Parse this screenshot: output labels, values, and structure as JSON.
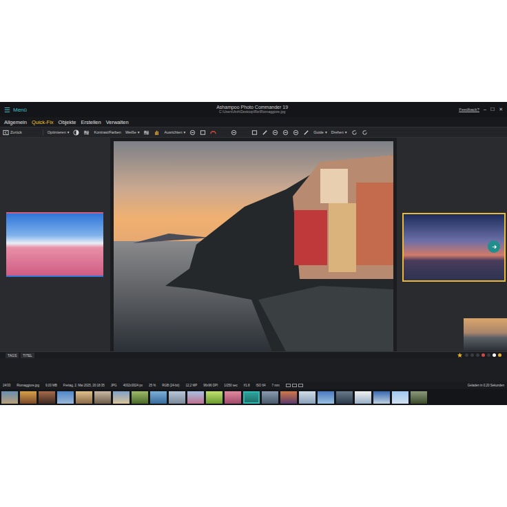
{
  "window": {
    "menu_icon": "☰",
    "menu_label": "Menü",
    "title": "Ashampoo Photo Commander 19",
    "path": "C:\\Users\\Anh\\Desktop\\Rio\\Riomaggiore.jpg",
    "feedback": "Feedback?",
    "controls": [
      "–",
      "☐",
      "✕"
    ]
  },
  "tabs": [
    {
      "label": "Allgemein",
      "selected": false
    },
    {
      "label": "Quick-Fix",
      "selected": true
    },
    {
      "label": "Objekte",
      "selected": false
    },
    {
      "label": "Erstellen",
      "selected": false
    },
    {
      "label": "Verwalten",
      "selected": false
    }
  ],
  "toolbar": {
    "back": "Zurück",
    "items": [
      {
        "label": "Optimieren",
        "arrow": "▾"
      },
      {
        "label": "Kontrast/Farben",
        "arrow": ""
      },
      {
        "label": "Weiße",
        "arrow": "▾"
      },
      {
        "label": "Ausrichten",
        "arrow": "▾"
      },
      {
        "label": "Guide",
        "arrow": "▾"
      },
      {
        "label": "Drehen",
        "arrow": "▾"
      }
    ]
  },
  "neighbors": {
    "previous": {
      "selected": false
    },
    "next": {
      "selected": true
    }
  },
  "info_tabs": [
    "TAGS",
    "TITEL"
  ],
  "status_bar": {
    "fields": [
      "24/33",
      "Riomaggiore.jpg",
      "9,03 MB",
      "Freitag, 2. Mai 2025, 20:18:35",
      "JPG",
      "4032x3024 px",
      "25 %",
      "RGB (24-bit)",
      "12,2 MP",
      "96x96 DPI",
      "1/250 sec",
      "f/1.8",
      "ISO 64",
      "7 mm"
    ],
    "load_time": "Geladen in 0,20 Sekunden"
  },
  "filmstrip": {
    "items": [
      {
        "selected": false
      },
      {
        "selected": false
      },
      {
        "selected": false
      },
      {
        "selected": false
      },
      {
        "selected": false
      },
      {
        "selected": false
      },
      {
        "selected": false
      },
      {
        "selected": false
      },
      {
        "selected": false
      },
      {
        "selected": false
      },
      {
        "selected": false
      },
      {
        "selected": false
      },
      {
        "selected": false
      },
      {
        "selected": true
      },
      {
        "selected": false
      },
      {
        "selected": false
      },
      {
        "selected": false
      },
      {
        "selected": false
      },
      {
        "selected": false
      },
      {
        "selected": false
      },
      {
        "selected": false
      },
      {
        "selected": false
      },
      {
        "selected": false
      }
    ]
  }
}
